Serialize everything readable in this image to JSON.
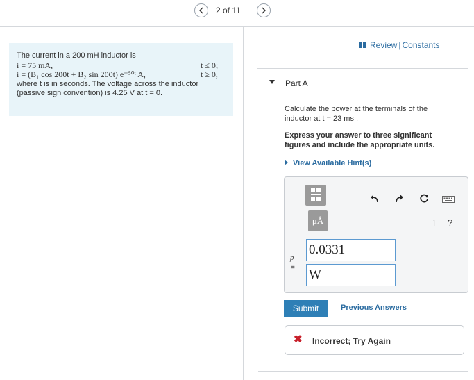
{
  "nav": {
    "page_counter": "2 of 11"
  },
  "problem": {
    "line1": "The current in a 200 mH inductor is",
    "line2_expr": "i = 75 mA,",
    "line2_cond": "t ≤ 0;",
    "line3_expr": "i = (B₁ cos 200t + B₂ sin 200t) e⁻⁵⁰ᵗ A,",
    "line3_cond": "t ≥ 0,",
    "line4": "where t is in seconds. The voltage across the inductor",
    "line5": "(passive sign convention) is 4.25 V at t = 0."
  },
  "header_links": {
    "review": "Review",
    "separator": "|",
    "constants": "Constants"
  },
  "part": {
    "title": "Part A",
    "question_line1": "Calculate the power at the terminals of the",
    "question_line2": "inductor at t = 23 ms .",
    "instructions_line1": "Express your answer to three significant",
    "instructions_line2": "figures and include the appropriate units.",
    "hint_label": "View Available Hint(s)"
  },
  "answer": {
    "variable": "p",
    "equals": "=",
    "value": "0.0331",
    "units": "W",
    "units_button_label": "μÅ",
    "help_label": "?",
    "bracket_label": "]"
  },
  "actions": {
    "submit_label": "Submit",
    "previous_answers_label": "Previous Answers"
  },
  "feedback": {
    "icon": "✖",
    "message": "Incorrect; Try Again",
    "color": "#c8202b"
  },
  "colors": {
    "accent": "#2a6ba0",
    "submit_bg": "#2e7fb6",
    "problem_bg": "#e8f4f9"
  }
}
